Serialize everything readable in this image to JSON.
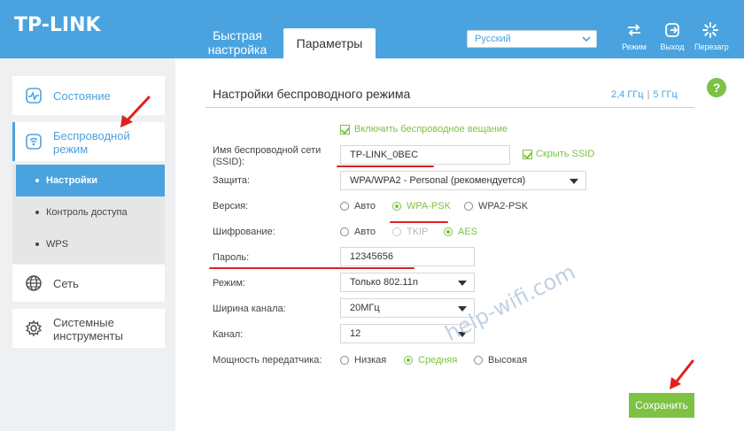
{
  "header": {
    "logo": "TP-LINK",
    "tabs": [
      {
        "label_line1": "Быстрая",
        "label_line2": "настройка"
      },
      {
        "label": "Параметры"
      }
    ],
    "language": "Русский",
    "buttons": [
      {
        "label": "Режим",
        "icon": "mode-switch-icon"
      },
      {
        "label": "Выход",
        "icon": "logout-icon"
      },
      {
        "label": "Перезагр",
        "icon": "reboot-icon"
      }
    ]
  },
  "sidebar": {
    "items": [
      {
        "label": "Состояние",
        "icon": "status-icon"
      },
      {
        "label_line1": "Беспроводной",
        "label_line2": "режим",
        "icon": "wireless-icon"
      },
      {
        "label": "Сеть",
        "icon": "globe-icon"
      },
      {
        "label_line1": "Системные",
        "label_line2": "инструменты",
        "icon": "gear-icon"
      }
    ],
    "submenu": [
      "Настройки",
      "Контроль доступа",
      "WPS"
    ]
  },
  "main": {
    "title": "Настройки беспроводного режима",
    "freq_24": "2,4 ГГц",
    "freq_sep": "|",
    "freq_5": "5 ГГц",
    "help": "?",
    "enable_broadcast": "Включить беспроводное вещание",
    "ssid_label_line1": "Имя беспроводной сети",
    "ssid_label_line2": "(SSID):",
    "ssid_value": "TP-LINK_0BEC",
    "hide_ssid": "Скрыть SSID",
    "security_label": "Защита:",
    "security_value": "WPA/WPA2 - Personal (рекомендуется)",
    "version_label": "Версия:",
    "version_options": [
      "Авто",
      "WPA-PSK",
      "WPA2-PSK"
    ],
    "version_selected": "WPA-PSK",
    "encryption_label": "Шифрование:",
    "encryption_options": [
      "Авто",
      "TKIP",
      "AES"
    ],
    "encryption_selected": "AES",
    "password_label": "Пароль:",
    "password_value": "12345656",
    "mode_label": "Режим:",
    "mode_value": "Только 802.11n",
    "width_label": "Ширина канала:",
    "width_value": "20МГц",
    "channel_label": "Канал:",
    "channel_value": "12",
    "power_label": "Мощность передатчика:",
    "power_options": [
      "Низкая",
      "Средняя",
      "Высокая"
    ],
    "power_selected": "Средняя",
    "save_label": "Сохранить"
  },
  "watermark": "help-wifi.com",
  "colors": {
    "header_blue": "#4aa3df",
    "accent_green": "#7dc243",
    "annotation_red": "#e02020"
  }
}
